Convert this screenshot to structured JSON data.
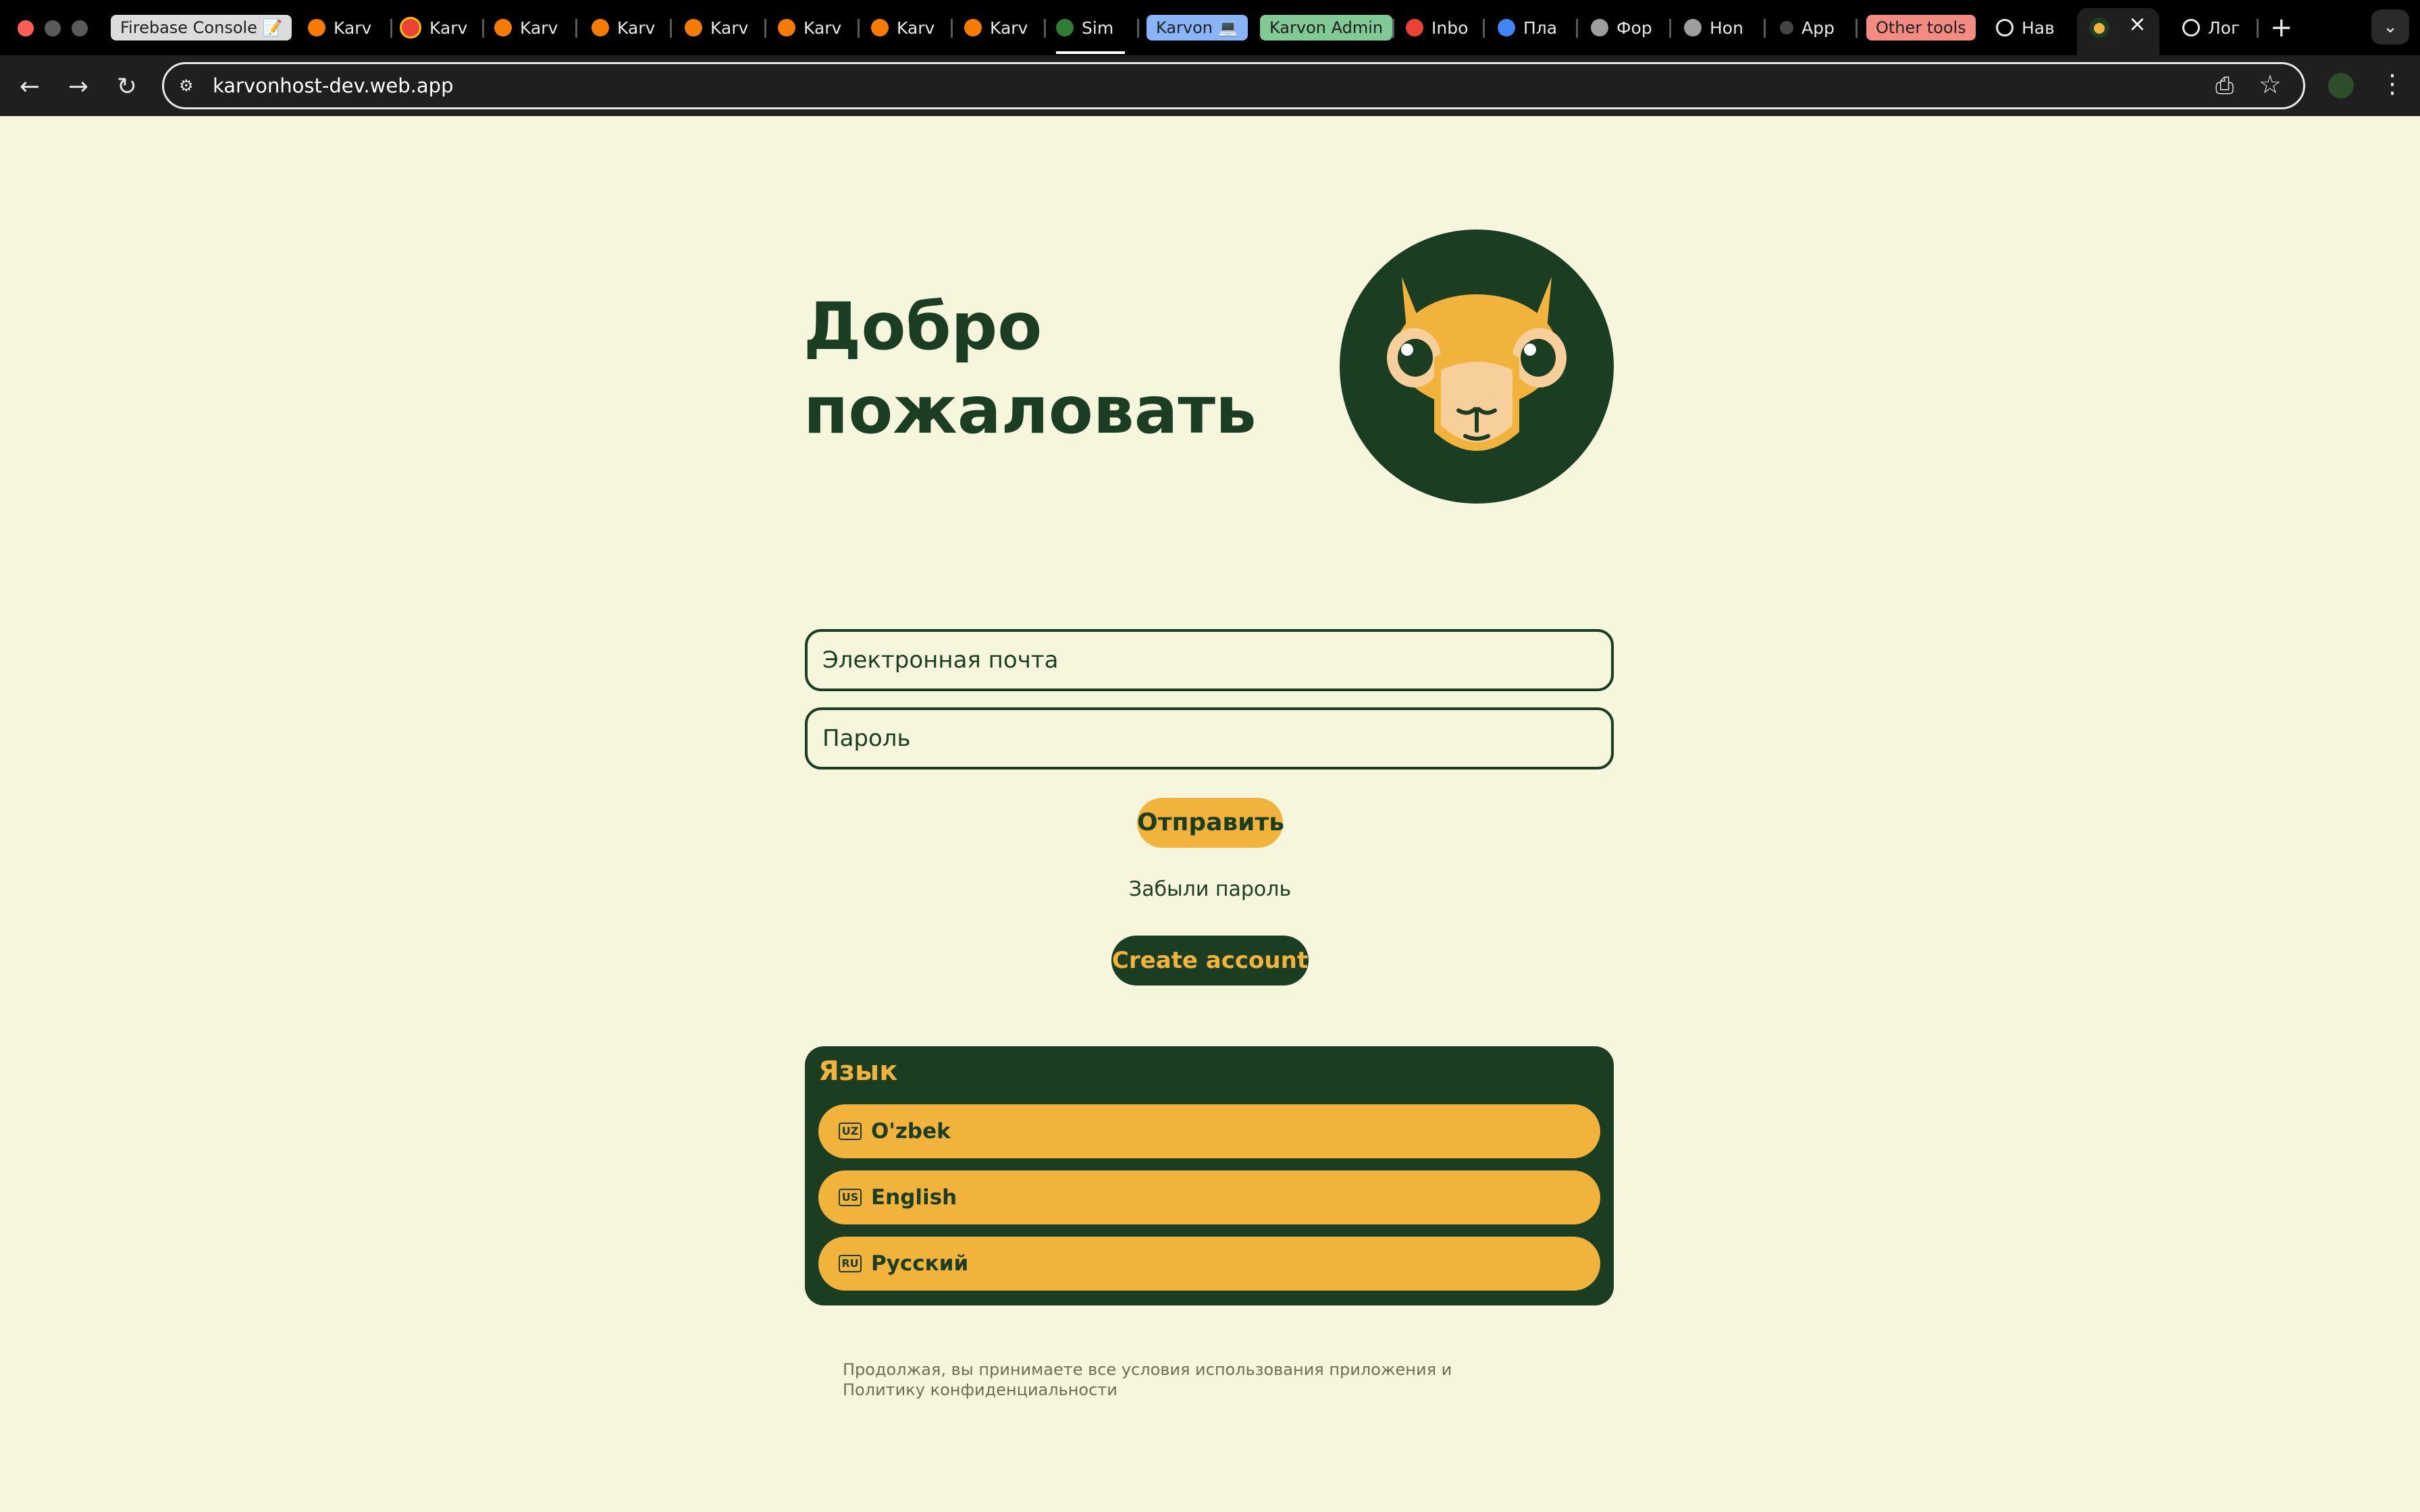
{
  "browser": {
    "tabs": [
      {
        "label": "Firebase Console 📝",
        "kind": "pill",
        "color": "#dcdcdc"
      },
      {
        "label": "Karv",
        "kind": "firebase"
      },
      {
        "label": "Karv",
        "kind": "chrome"
      },
      {
        "label": "Karv",
        "kind": "firebase"
      },
      {
        "label": "Karv",
        "kind": "firebase"
      },
      {
        "label": "Karv",
        "kind": "firebase"
      },
      {
        "label": "Karv",
        "kind": "firebase"
      },
      {
        "label": "Karv",
        "kind": "firebase"
      },
      {
        "label": "Karv",
        "kind": "firebase"
      },
      {
        "label": "Sim",
        "kind": "check"
      },
      {
        "label": "Karvon 💻",
        "kind": "pill",
        "color": "#8ab4f8"
      },
      {
        "label": "Karvon Admin",
        "kind": "pill",
        "color": "#81c995"
      },
      {
        "label": "Inbo",
        "kind": "gmail"
      },
      {
        "label": "Пла",
        "kind": "globe"
      },
      {
        "label": "Фор",
        "kind": "g"
      },
      {
        "label": "Hon",
        "kind": "globe"
      },
      {
        "label": "App",
        "kind": "apple"
      },
      {
        "label": "Other tools",
        "kind": "pill",
        "color": "#f28b82"
      },
      {
        "label": "Нав",
        "kind": "circle"
      },
      {
        "label": "",
        "kind": "active"
      },
      {
        "label": "Лог",
        "kind": "circle"
      }
    ],
    "url": "karvonhost-dev.web.app",
    "accent": "#f2b33d"
  },
  "page": {
    "welcome_line1": "Добро",
    "welcome_line2": "пожаловать",
    "email_placeholder": "Электронная почта",
    "password_placeholder": "Пароль",
    "submit_label": "Отправить",
    "forgot_label": "Забыли пароль",
    "create_account_label": "Create account",
    "language": {
      "title": "Язык",
      "options": [
        {
          "flag": "UZ",
          "label": "O'zbek"
        },
        {
          "flag": "US",
          "label": "English"
        },
        {
          "flag": "RU",
          "label": "Русский"
        }
      ]
    },
    "terms": "Продолжая, вы принимаете все условия использования приложения и Политику конфиденциальности",
    "colors": {
      "background": "#f6f5dd",
      "dark_green": "#1b3e23",
      "yellow": "#f2b33d"
    }
  }
}
